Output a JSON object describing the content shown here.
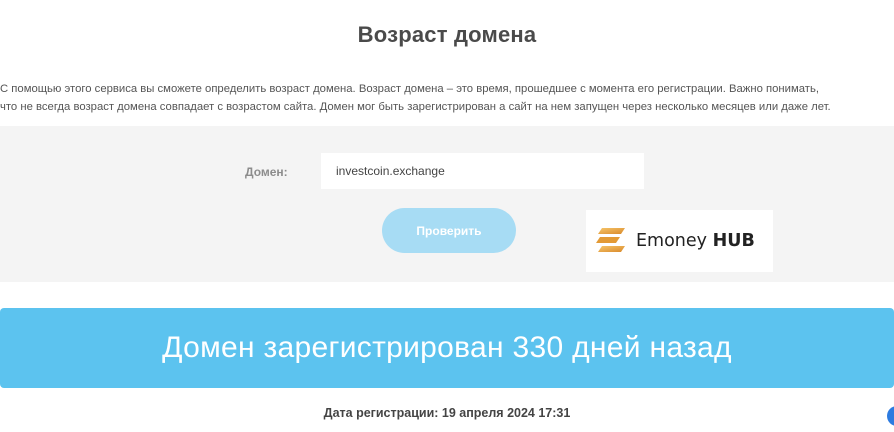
{
  "page": {
    "title": "Возраст домена",
    "description_line1": "С помощью этого сервиса вы сможете определить возраст домена. Возраст домена – это время, прошедшее с момента его регистрации. Важно понимать,",
    "description_line2": "что не всегда возраст домена совпадает с возрастом сайта. Домен мог быть зарегистрирован а сайт на нем запущен через несколько месяцев или даже лет."
  },
  "form": {
    "domain_label": "Домен:",
    "domain_value": "investcoin.exchange",
    "check_button_label": "Проверить"
  },
  "logo": {
    "brand_name": "Emoney",
    "brand_suffix": "HUB",
    "icon": "e-stack-logo-icon",
    "accent_color": "#e8a33a"
  },
  "result": {
    "message": "Домен зарегистрирован 330 дней назад",
    "registration_date": "Дата регистрации: 19 апреля 2024 17:31"
  },
  "colors": {
    "banner": "#5cc3ef",
    "button": "#a7dcf4",
    "panel": "#f4f4f4",
    "widget": "#2d7be0"
  }
}
